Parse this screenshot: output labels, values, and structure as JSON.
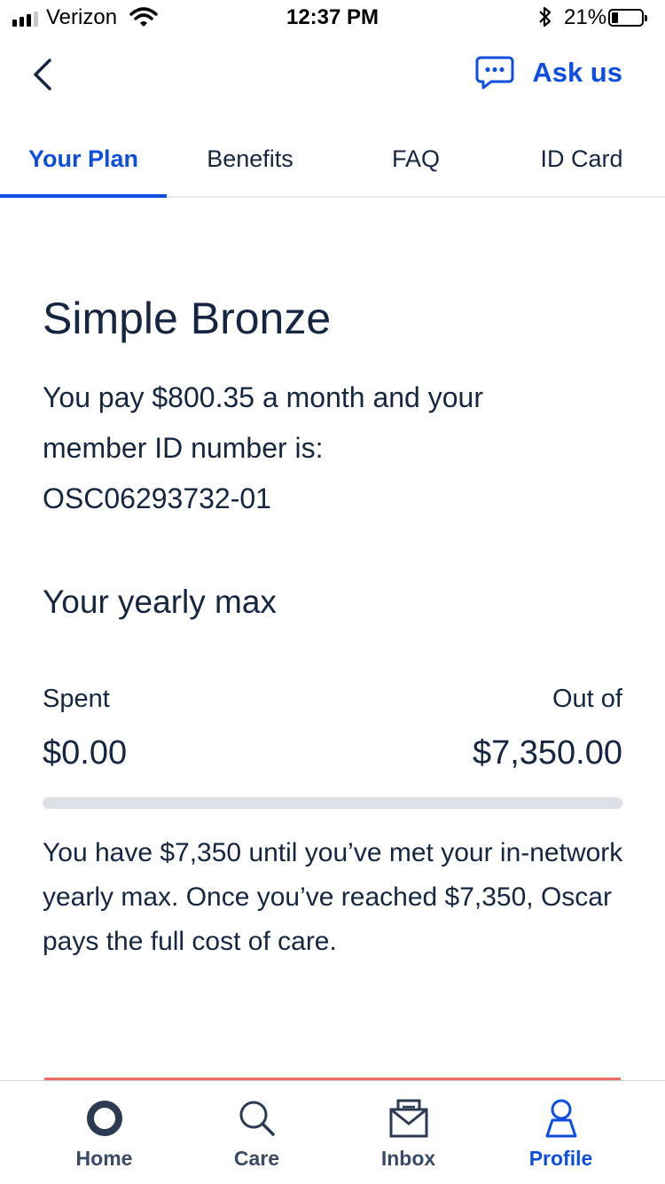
{
  "status_bar": {
    "carrier": "Verizon",
    "time": "12:37 PM",
    "battery": "21%",
    "battery_level": 0.21
  },
  "header": {
    "ask_label": "Ask us"
  },
  "tabs": [
    {
      "label": "Your Plan",
      "active": true
    },
    {
      "label": "Benefits",
      "active": false
    },
    {
      "label": "FAQ",
      "active": false
    },
    {
      "label": "ID Card",
      "active": false
    }
  ],
  "plan": {
    "name": "Simple Bronze",
    "desc_line1": "You pay $800.35 a month and your",
    "desc_line2": "member ID number is:",
    "member_id": "OSC06293732-01"
  },
  "yearly_max": {
    "title": "Your yearly max",
    "spent_label": "Spent",
    "spent_value": "$0.00",
    "outof_label": "Out of",
    "total_value": "$7,350.00",
    "progress_fraction": 0,
    "note": "You have $7,350 until you’ve met your in-network yearly max. Once you’ve reached $7,350, Oscar pays the full cost of care."
  },
  "bottom_nav": [
    {
      "label": "Home",
      "icon": "home-icon",
      "active": false
    },
    {
      "label": "Care",
      "icon": "search-icon",
      "active": false
    },
    {
      "label": "Inbox",
      "icon": "inbox-icon",
      "active": false
    },
    {
      "label": "Profile",
      "icon": "profile-icon",
      "active": true
    }
  ],
  "colors": {
    "accent": "#0d4de0",
    "text": "#162640",
    "track": "#dde0e6",
    "divider_red": "#e96b5b"
  }
}
